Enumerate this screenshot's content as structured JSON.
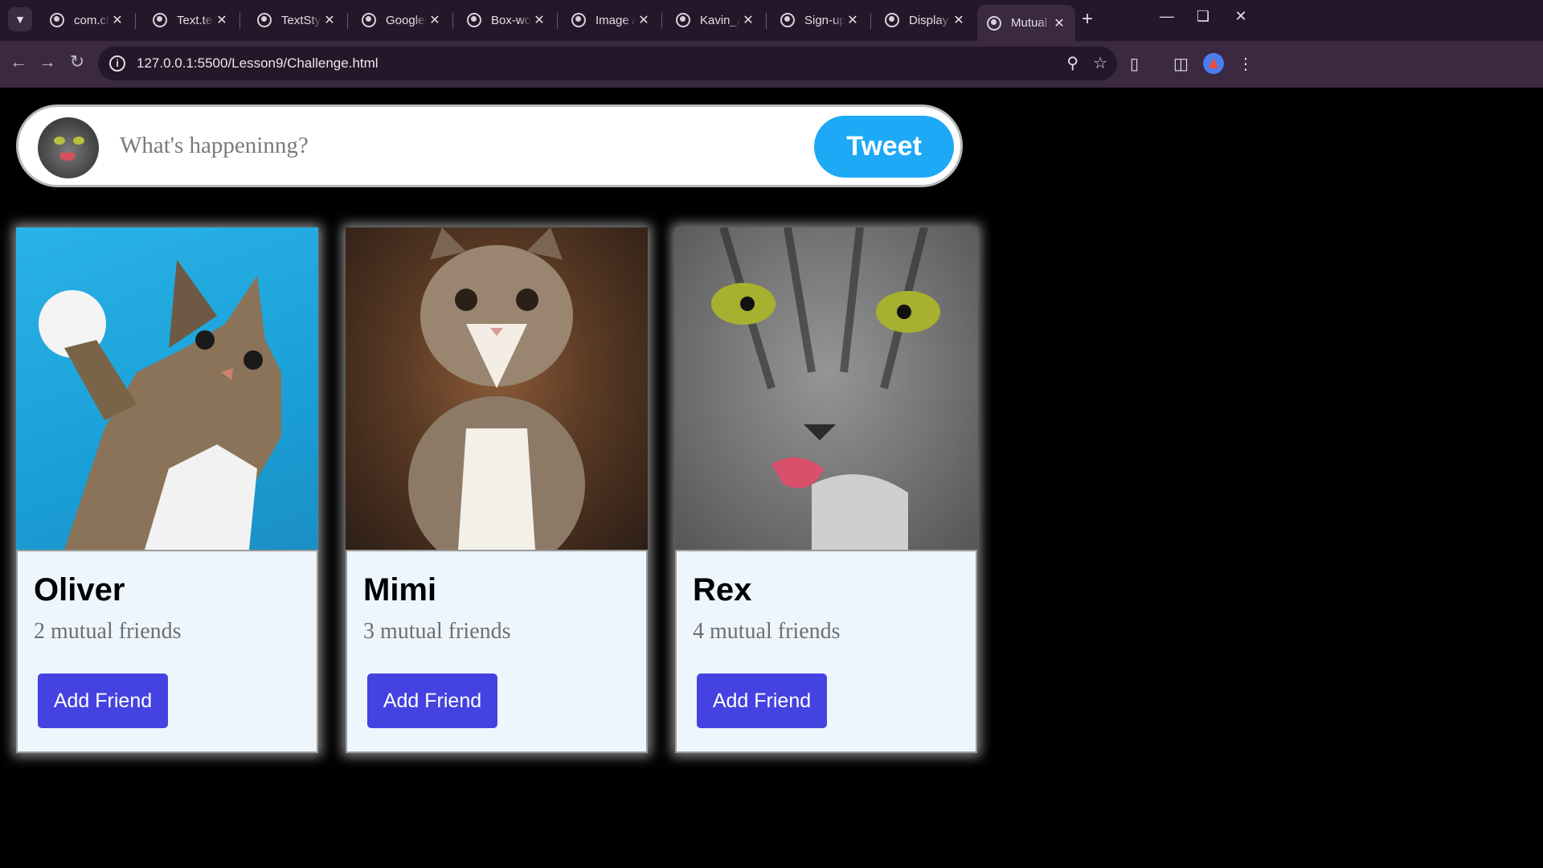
{
  "browser": {
    "tabs": [
      {
        "title": "com.challe",
        "active": false
      },
      {
        "title": "Text.techcr",
        "active": false
      },
      {
        "title": "TextStyle.te",
        "active": false
      },
      {
        "title": "GoogleFon",
        "active": false
      },
      {
        "title": "Box-work",
        "active": false
      },
      {
        "title": "Image And",
        "active": false
      },
      {
        "title": "Kavin_Adit",
        "active": false
      },
      {
        "title": "Sign-up-F",
        "active": false
      },
      {
        "title": "Display",
        "active": false
      },
      {
        "title": "Mutual Fri",
        "active": true
      }
    ],
    "url": "127.0.0.1:5500/Lesson9/Challenge.html"
  },
  "tweet": {
    "placeholder": "What's happeninng?",
    "button_label": "Tweet",
    "button_color": "#1da9f5"
  },
  "cards": [
    {
      "name": "Oliver",
      "mutual": "2 mutual friends",
      "button_label": "Add Friend"
    },
    {
      "name": "Mimi",
      "mutual": "3 mutual friends",
      "button_label": "Add Friend"
    },
    {
      "name": "Rex",
      "mutual": "4 mutual friends",
      "button_label": "Add Friend"
    }
  ],
  "colors": {
    "page_background": "#000000",
    "card_body": "#eef6fd",
    "add_friend_button": "#4442e0"
  },
  "icons": {
    "tab_search": "chevron-down-icon",
    "tab_favicon": "globe-icon",
    "tab_close": "close-icon",
    "new_tab": "plus-icon",
    "back": "arrow-left-icon",
    "forward": "arrow-right-icon",
    "reload": "reload-icon",
    "site_info": "info-icon",
    "zoom": "zoom-icon",
    "bookmark": "star-icon",
    "extensions": "puzzle-icon",
    "side_panel": "side-panel-icon",
    "menu": "kebab-menu-icon"
  }
}
